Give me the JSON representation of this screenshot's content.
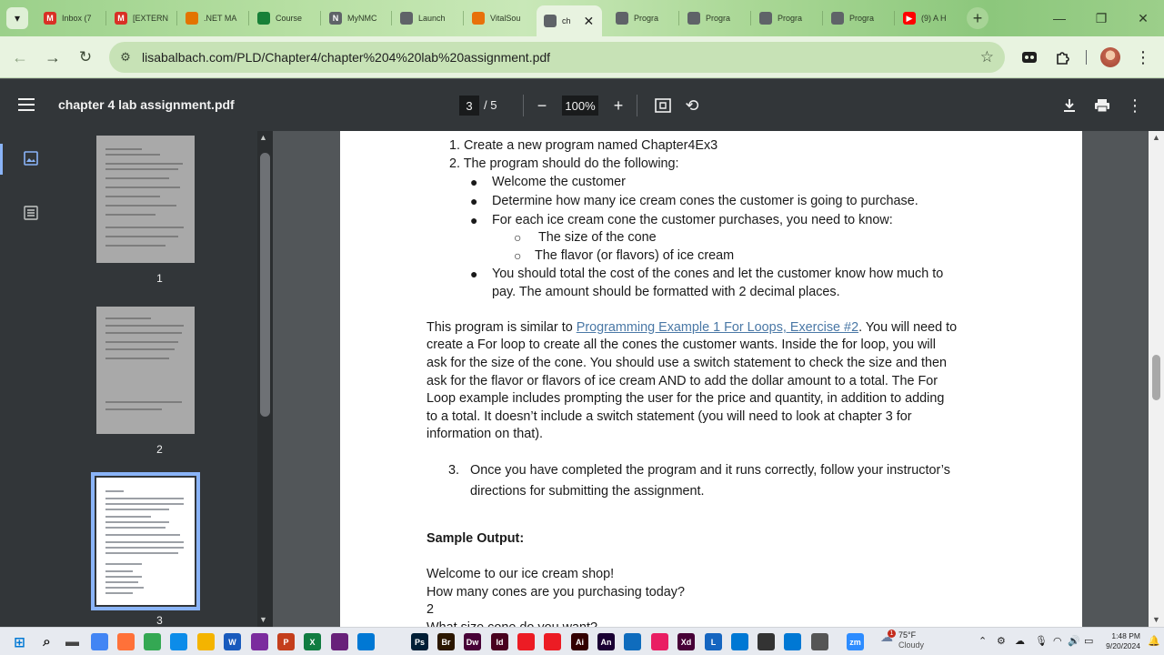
{
  "tabs": [
    {
      "label": "Inbox (7",
      "fav_color": "#d93025",
      "fav_glyph": "M"
    },
    {
      "label": "[EXTERN",
      "fav_color": "#d93025",
      "fav_glyph": "M"
    },
    {
      "label": ".NET MA",
      "fav_color": "#e37400",
      "fav_glyph": ""
    },
    {
      "label": "Course",
      "fav_color": "#188038",
      "fav_glyph": ""
    },
    {
      "label": "MyNMC",
      "fav_color": "#5f6368",
      "fav_glyph": "N"
    },
    {
      "label": "Launch",
      "fav_color": "#5f6368",
      "fav_glyph": ""
    },
    {
      "label": "VitalSou",
      "fav_color": "#e8710a",
      "fav_glyph": ""
    },
    {
      "label": "ch",
      "fav_color": "#5f6368",
      "fav_glyph": ""
    },
    {
      "label": "Progra",
      "fav_color": "#5f6368",
      "fav_glyph": ""
    },
    {
      "label": "Progra",
      "fav_color": "#5f6368",
      "fav_glyph": ""
    },
    {
      "label": "Progra",
      "fav_color": "#5f6368",
      "fav_glyph": ""
    },
    {
      "label": "Progra",
      "fav_color": "#5f6368",
      "fav_glyph": ""
    },
    {
      "label": "(9) A H",
      "fav_color": "#ff0000",
      "fav_glyph": "▶"
    }
  ],
  "browser": {
    "url": "lisabalbach.com/PLD/Chapter4/chapter%204%20lab%20assignment.pdf"
  },
  "pdf": {
    "title": "chapter 4 lab assignment.pdf",
    "current_page": "3",
    "page_total": "/  5",
    "zoom": "100%",
    "thumbnails": [
      {
        "label": "1"
      },
      {
        "label": "2"
      },
      {
        "label": "3"
      }
    ]
  },
  "document": {
    "step1": "1.   Create a new program named Chapter4Ex3",
    "step2": "2.  The program should do the following:",
    "bullet1": "Welcome the customer",
    "bullet2": "Determine how many ice cream cones the customer is going to purchase.",
    "bullet3": "For each ice cream cone the customer purchases, you need to know:",
    "sub1": "The size of the cone",
    "sub2": "The flavor (or flavors) of ice cream",
    "bullet4_line1": "You should total the cost of the cones and let the customer know how much to",
    "bullet4_line2": "pay.  The amount should be formatted with 2 decimal places.",
    "para_prefix": "This program is similar to ",
    "para_link": "Programming Example 1 For Loops, Exercise #2",
    "para_suffix": ".   You will need to",
    "para_line2": "create a For loop to create all the cones the customer wants.   Inside the for loop, you will",
    "para_line3": "ask for the size of the cone.   You should use a switch statement to check the size and then",
    "para_line4": "ask for the flavor or flavors of ice cream AND to add the dollar amount to a total.   The For",
    "para_line5": "Loop example includes prompting the user for the price and quantity, in addition to adding",
    "para_line6": "to a total.  It doesn’t include a switch statement (you will need to look at chapter 3 for",
    "para_line7": "information on that).",
    "step3_num": "3.",
    "step3_line1": "Once you have completed the program and it runs correctly, follow your instructor’s",
    "step3_line2": "directions for submitting the assignment.",
    "sample_heading": "Sample Output:",
    "out1": "Welcome to our ice cream shop!",
    "out2": "How many cones are you purchasing today?",
    "out3": "2",
    "out4": "What size cone do you want?"
  },
  "taskbar": {
    "weather_badge": "1",
    "weather_temp": "75°F",
    "weather_desc": "Cloudy",
    "time": "1:48 PM",
    "date": "9/20/2024",
    "apps": [
      {
        "glyph": "⊞",
        "color": "#0078d4"
      },
      {
        "glyph": "⌕",
        "color": "#1f1f1f"
      },
      {
        "glyph": "▬",
        "color": "#444444"
      },
      {
        "glyph": "",
        "color": "#4285f4"
      },
      {
        "glyph": "",
        "color": "#ff7139"
      },
      {
        "glyph": "",
        "color": "#34a853"
      },
      {
        "glyph": "",
        "color": "#0c8ce9"
      },
      {
        "glyph": "",
        "color": "#f4b400"
      },
      {
        "glyph": "W",
        "color": "#185abd"
      },
      {
        "glyph": "",
        "color": "#7b2c9e"
      },
      {
        "glyph": "P",
        "color": "#c43e1c"
      },
      {
        "glyph": "X",
        "color": "#107c41"
      },
      {
        "glyph": "",
        "color": "#68217a"
      },
      {
        "glyph": "",
        "color": "#0078d4"
      },
      {
        "glyph": "Ps",
        "color": "#001e36"
      },
      {
        "glyph": "Br",
        "color": "#2b1700"
      },
      {
        "glyph": "Dw",
        "color": "#470137"
      },
      {
        "glyph": "Id",
        "color": "#49021f"
      },
      {
        "glyph": "",
        "color": "#ec1c24"
      },
      {
        "glyph": "",
        "color": "#ec1c24"
      },
      {
        "glyph": "Ai",
        "color": "#330000"
      },
      {
        "glyph": "An",
        "color": "#1a0033"
      },
      {
        "glyph": "",
        "color": "#0f6cbd"
      },
      {
        "glyph": "",
        "color": "#e91e63"
      },
      {
        "glyph": "Xd",
        "color": "#470137"
      },
      {
        "glyph": "L",
        "color": "#1565c0"
      },
      {
        "glyph": "",
        "color": "#0078d4"
      },
      {
        "glyph": "",
        "color": "#333333"
      },
      {
        "glyph": "",
        "color": "#0078d4"
      },
      {
        "glyph": "",
        "color": "#555555"
      },
      {
        "glyph": "zm",
        "color": "#2d8cff"
      }
    ]
  }
}
